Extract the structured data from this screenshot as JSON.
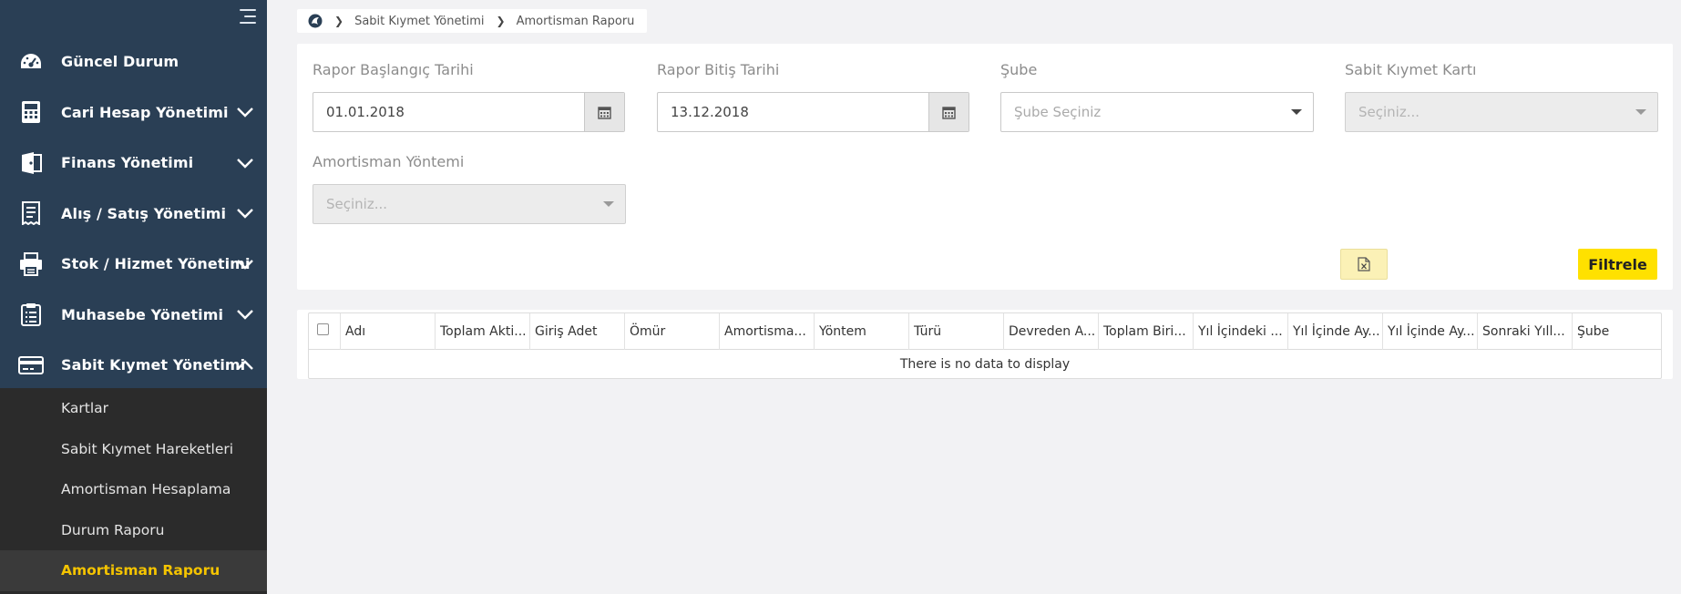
{
  "sidebar": {
    "menu": [
      {
        "label": "Güncel Durum",
        "icon": "dashboard-icon"
      },
      {
        "label": "Cari Hesap Yönetimi",
        "icon": "calculator-icon"
      },
      {
        "label": "Finans Yönetimi",
        "icon": "wallet-icon"
      },
      {
        "label": "Alış / Satış Yönetimi",
        "icon": "receipt-icon"
      },
      {
        "label": "Stok / Hizmet Yönetimi",
        "icon": "printer-icon"
      },
      {
        "label": "Muhasebe Yönetimi",
        "icon": "clipboard-icon"
      },
      {
        "label": "Sabit Kıymet Yönetimi",
        "icon": "credit-card-icon"
      }
    ],
    "submenu": [
      {
        "label": "Kartlar"
      },
      {
        "label": "Sabit Kıymet Hareketleri"
      },
      {
        "label": "Amortisman Hesaplama"
      },
      {
        "label": "Durum Raporu"
      },
      {
        "label": "Amortisman Raporu",
        "active": true
      }
    ],
    "active_color": "#f5c400"
  },
  "breadcrumb": {
    "items": [
      "Sabit Kıymet Yönetimi",
      "Amortisman Raporu"
    ]
  },
  "filters": {
    "start_date_label": "Rapor Başlangıç Tarihi",
    "start_date_value": "01.01.2018",
    "end_date_label": "Rapor Bitiş Tarihi",
    "end_date_value": "13.12.2018",
    "branch_label": "Şube",
    "branch_placeholder": "Şube Seçiniz",
    "asset_card_label": "Sabit Kıymet Kartı",
    "asset_card_placeholder": "Seçiniz...",
    "method_label": "Amortisman Yöntemi",
    "method_placeholder": "Seçiniz...",
    "filter_button": "Filtrele",
    "excel_icon": "excel-icon"
  },
  "grid": {
    "columns": [
      "Adı",
      "Toplam Akti...",
      "Giriş Adet",
      "Ömür",
      "Amortisma...",
      "Yöntem",
      "Türü",
      "Devreden A...",
      "Toplam Biri...",
      "Yıl İçindeki ...",
      "Yıl İçinde Ay...",
      "Yıl İçinde Ay...",
      "Sonraki Yıll...",
      "Şube"
    ],
    "empty_text": "There is no data to display"
  },
  "colors": {
    "sidebar_bg": "#2a3f55",
    "submenu_bg": "#2b2b2b",
    "filter_button": "#ffe100",
    "excel_button": "#fbf1b6"
  }
}
